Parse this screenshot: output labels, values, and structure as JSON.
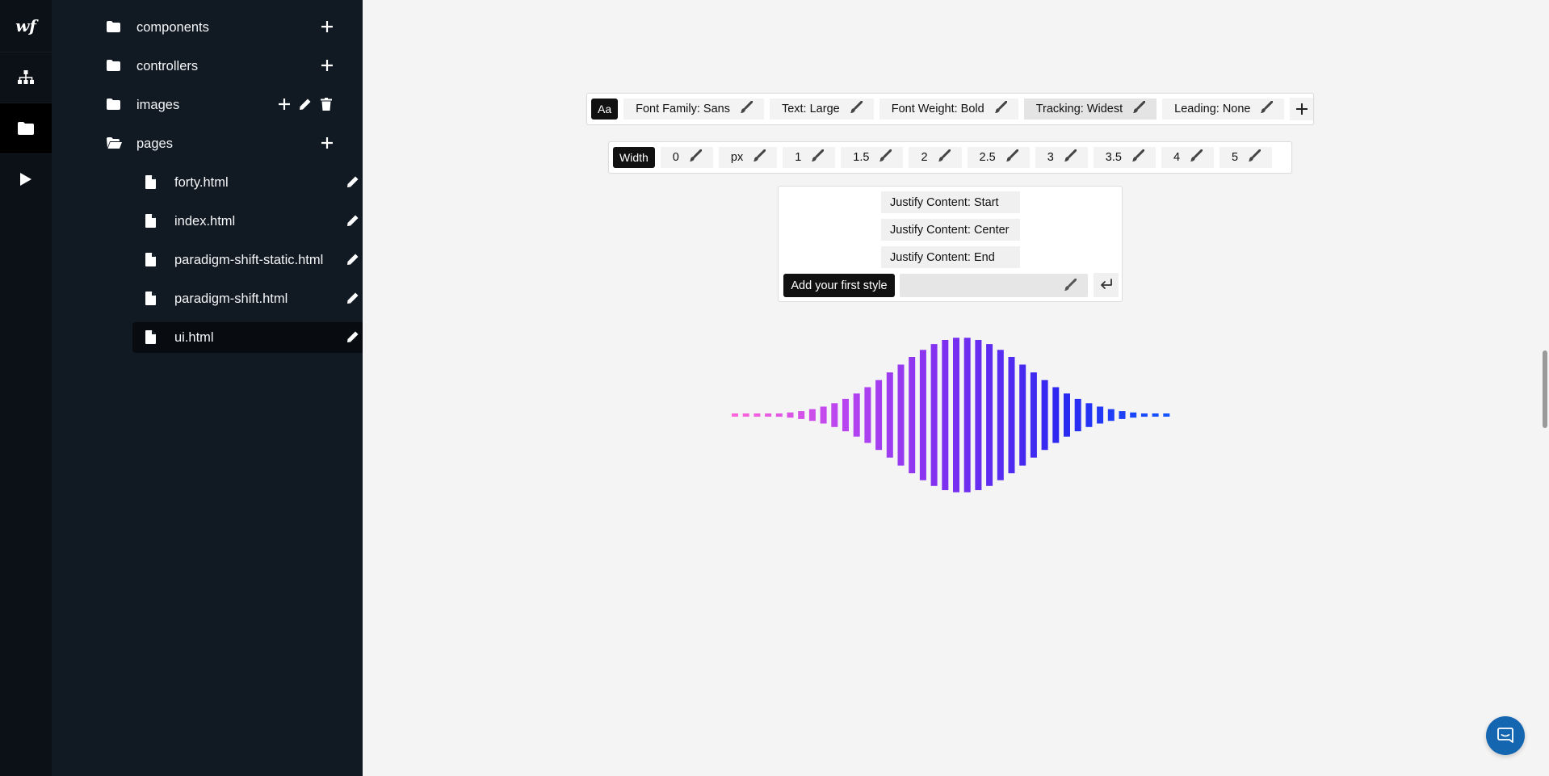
{
  "app": {
    "logo_text": "wf",
    "rail_icons": [
      "logo-icon",
      "sitemap-icon",
      "folder-icon",
      "play-icon"
    ]
  },
  "sidebar": {
    "folders": [
      {
        "label": "components",
        "open": false,
        "actions": [
          "add"
        ]
      },
      {
        "label": "controllers",
        "open": false,
        "actions": [
          "add"
        ]
      },
      {
        "label": "images",
        "open": false,
        "actions": [
          "add",
          "edit",
          "delete"
        ]
      },
      {
        "label": "pages",
        "open": true,
        "actions": [
          "add"
        ]
      }
    ],
    "files": [
      {
        "label": "forty.html",
        "selected": false
      },
      {
        "label": "index.html",
        "selected": false
      },
      {
        "label": "paradigm-shift-static.html",
        "selected": false
      },
      {
        "label": "paradigm-shift.html",
        "selected": false
      },
      {
        "label": "ui.html",
        "selected": true
      }
    ]
  },
  "toolbar_text": {
    "tag": "Aa",
    "chips": [
      "Font Family: Sans",
      "Text: Large",
      "Font Weight: Bold",
      "Tracking: Widest",
      "Leading: None"
    ],
    "highlighted_chip": "Tracking: Widest"
  },
  "toolbar_width": {
    "tag": "Width",
    "chips": [
      "0",
      "px",
      "1",
      "1.5",
      "2",
      "2.5",
      "3",
      "3.5",
      "4",
      "5"
    ]
  },
  "style_panel": {
    "options": [
      "Justify Content: Start",
      "Justify Content: Center",
      "Justify Content: End"
    ],
    "add_label": "Add your first style",
    "input_value": ""
  },
  "waveform": {
    "bar_count": 40,
    "gradient": [
      "#ff66d9",
      "#b945f0",
      "#7a2ff0",
      "#2c28f0",
      "#1255ff"
    ]
  },
  "colors": {
    "rail_bg": "#0c1118",
    "sidebar_bg": "#111923",
    "canvas_bg": "#f4f4f4",
    "chat_button": "#1566b0"
  }
}
